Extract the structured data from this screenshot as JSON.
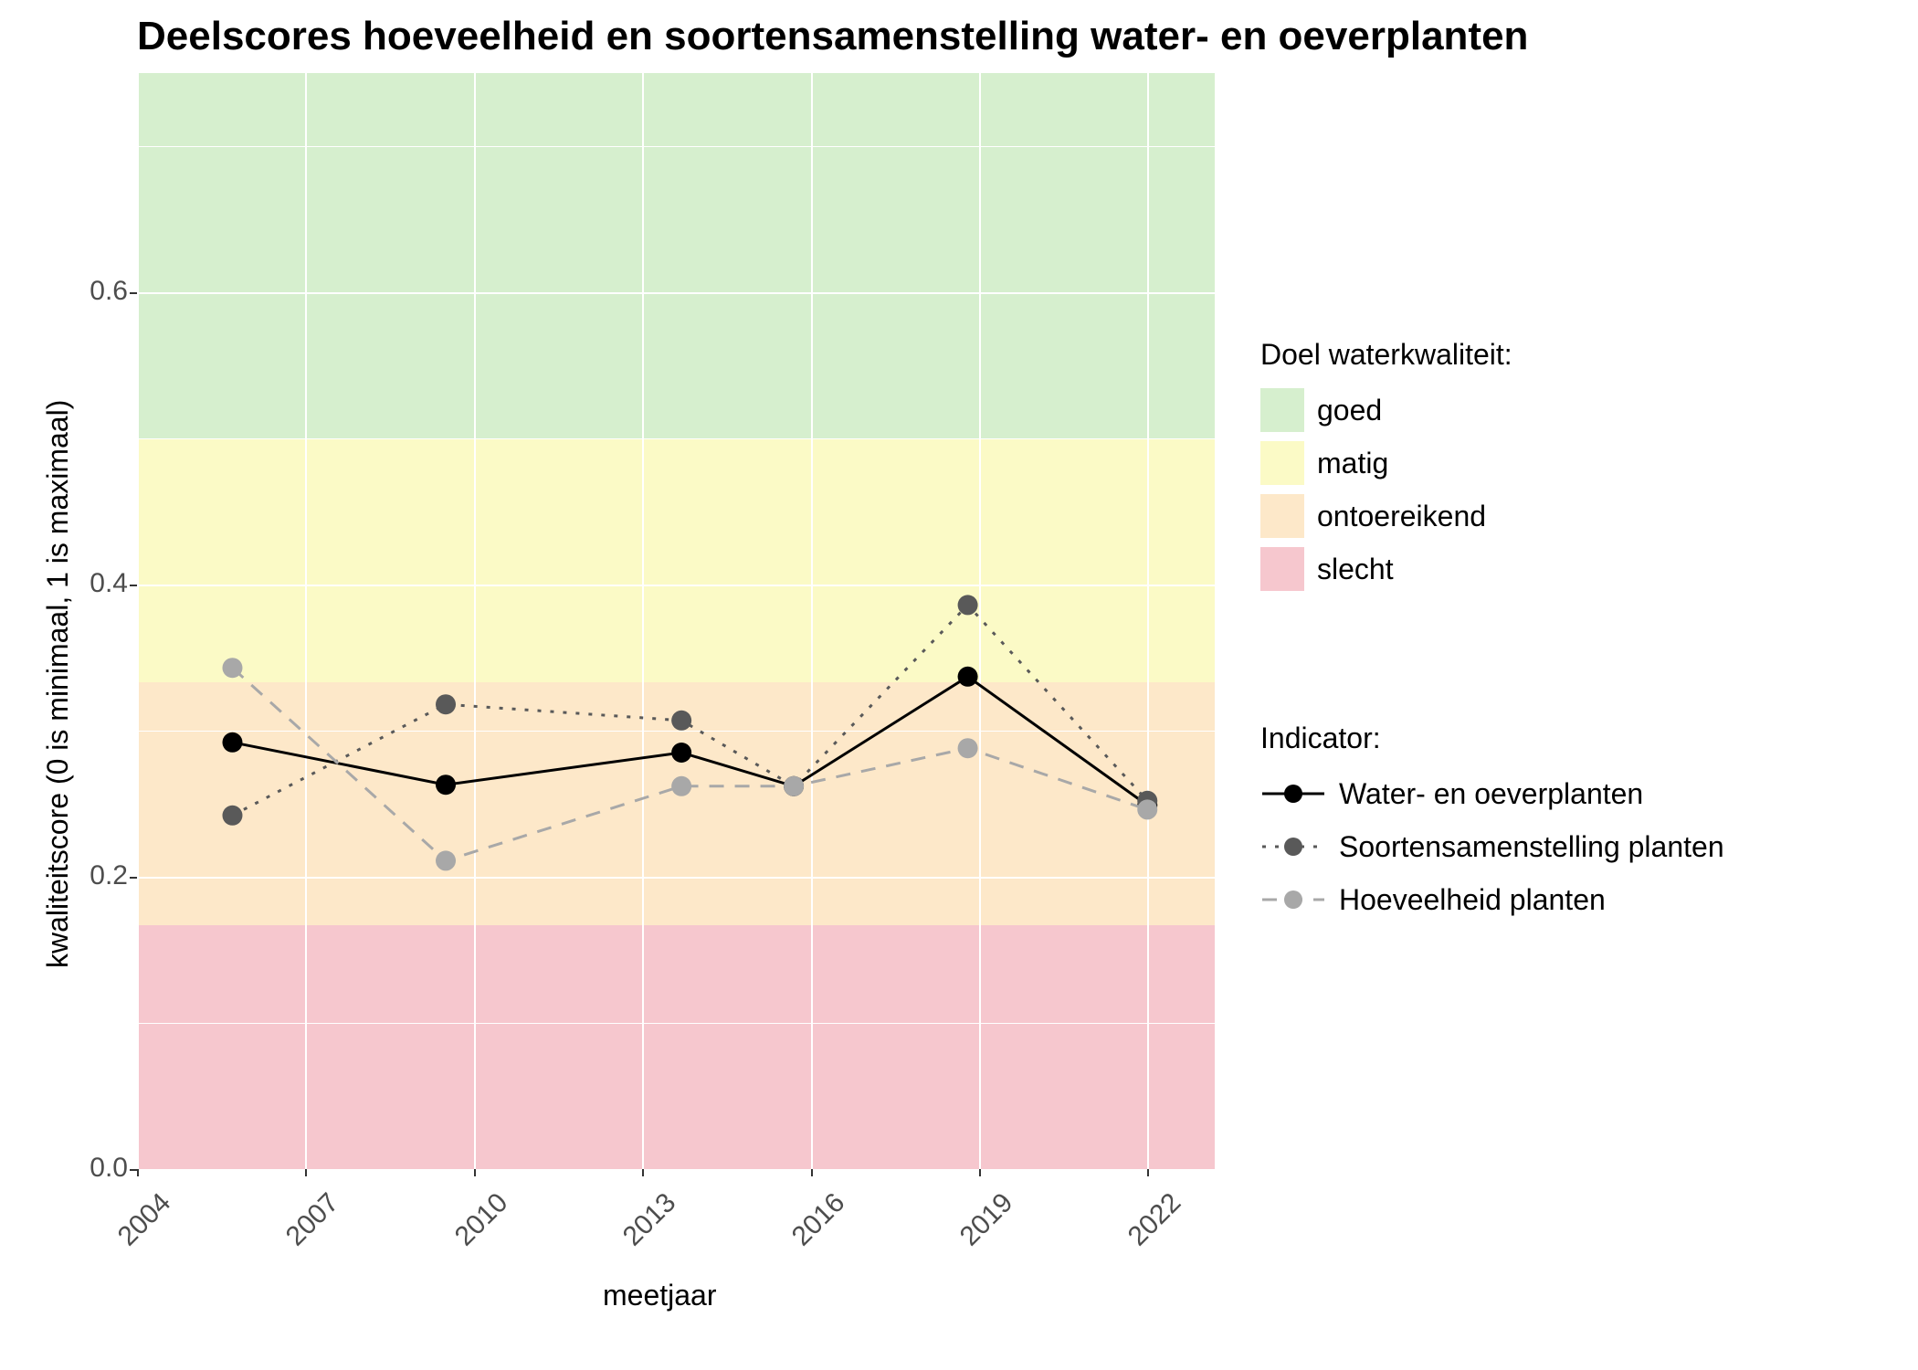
{
  "chart_data": {
    "type": "line",
    "title": "Deelscores hoeveelheid en soortensamenstelling water- en oeverplanten",
    "xlabel": "meetjaar",
    "ylabel": "kwaliteitscore (0 is minimaal, 1 is maximaal)",
    "xlim": [
      2004,
      2023.2
    ],
    "ylim": [
      0.0,
      0.75
    ],
    "x_ticks": [
      2004,
      2007,
      2010,
      2013,
      2016,
      2019,
      2022
    ],
    "y_ticks": [
      0.0,
      0.2,
      0.4,
      0.6
    ],
    "bands": [
      {
        "name": "slecht",
        "from": 0.0,
        "to": 0.167,
        "color": "#f6c7ce"
      },
      {
        "name": "ontoereikend",
        "from": 0.167,
        "to": 0.333,
        "color": "#fde8c9"
      },
      {
        "name": "matig",
        "from": 0.333,
        "to": 0.5,
        "color": "#fbfac6"
      },
      {
        "name": "goed",
        "from": 0.5,
        "to": 0.75,
        "color": "#d6efce"
      }
    ],
    "x": [
      2005.7,
      2009.5,
      2013.7,
      2015.7,
      2018.8,
      2022
    ],
    "series": [
      {
        "name": "Water- en oeverplanten",
        "color": "#000000",
        "dash": "solid",
        "point_color": "#000000",
        "values": [
          0.292,
          0.263,
          0.285,
          0.262,
          0.337,
          0.249
        ]
      },
      {
        "name": "Soortensamenstelling planten",
        "color": "#595959",
        "dash": "dotted",
        "point_color": "#595959",
        "values": [
          0.242,
          0.318,
          0.307,
          0.262,
          0.386,
          0.252
        ]
      },
      {
        "name": "Hoeveelheid planten",
        "color": "#a8a8a8",
        "dash": "dashed",
        "point_color": "#a8a8a8",
        "values": [
          0.343,
          0.211,
          0.262,
          0.262,
          0.288,
          0.246
        ]
      }
    ],
    "legend_doel_title": "Doel waterkwaliteit:",
    "legend_indicator_title": "Indicator:"
  }
}
